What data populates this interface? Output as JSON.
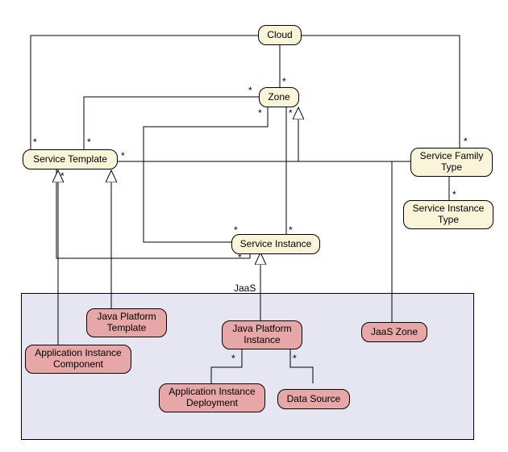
{
  "nodes": {
    "cloud": {
      "label": "Cloud"
    },
    "zone": {
      "label": "Zone"
    },
    "service_template": {
      "label": "Service Template"
    },
    "service_family_type": {
      "label": "Service Family\nType"
    },
    "service_instance_type": {
      "label": "Service Instance\nType"
    },
    "service_instance": {
      "label": "Service Instance"
    },
    "java_platform_template": {
      "label": "Java Platform\nTemplate"
    },
    "application_instance_component": {
      "label": "Application Instance\nComponent"
    },
    "java_platform_instance": {
      "label": "Java Platform\nInstance"
    },
    "application_instance_deployment": {
      "label": "Application Instance\nDeployment"
    },
    "data_source": {
      "label": "Data Source"
    },
    "jaas_zone": {
      "label": "JaaS Zone"
    }
  },
  "container": {
    "label": "JaaS"
  },
  "multiplicity": "*",
  "chart_data": {
    "type": "diagram",
    "title": "",
    "nodes": [
      {
        "id": "cloud",
        "label": "Cloud",
        "stereotype": "generic"
      },
      {
        "id": "zone",
        "label": "Zone",
        "stereotype": "generic"
      },
      {
        "id": "service_template",
        "label": "Service Template",
        "stereotype": "generic"
      },
      {
        "id": "service_family_type",
        "label": "Service Family Type",
        "stereotype": "generic"
      },
      {
        "id": "service_instance_type",
        "label": "Service Instance Type",
        "stereotype": "generic"
      },
      {
        "id": "service_instance",
        "label": "Service Instance",
        "stereotype": "generic"
      },
      {
        "id": "java_platform_template",
        "label": "Java Platform Template",
        "stereotype": "jaas"
      },
      {
        "id": "application_instance_component",
        "label": "Application Instance Component",
        "stereotype": "jaas"
      },
      {
        "id": "java_platform_instance",
        "label": "Java Platform Instance",
        "stereotype": "jaas"
      },
      {
        "id": "application_instance_deployment",
        "label": "Application Instance Deployment",
        "stereotype": "jaas"
      },
      {
        "id": "data_source",
        "label": "Data Source",
        "stereotype": "jaas"
      },
      {
        "id": "jaas_zone",
        "label": "JaaS Zone",
        "stereotype": "jaas"
      }
    ],
    "containers": [
      {
        "id": "jaas",
        "label": "JaaS",
        "members": [
          "java_platform_template",
          "application_instance_component",
          "java_platform_instance",
          "application_instance_deployment",
          "data_source",
          "jaas_zone"
        ]
      }
    ],
    "associations": [
      {
        "from": "cloud",
        "to": "zone",
        "from_mult": "",
        "to_mult": "*"
      },
      {
        "from": "cloud",
        "to": "service_template",
        "from_mult": "",
        "to_mult": "*"
      },
      {
        "from": "cloud",
        "to": "service_family_type",
        "from_mult": "",
        "to_mult": "*"
      },
      {
        "from": "zone",
        "to": "service_template",
        "from_mult": "*",
        "to_mult": "*"
      },
      {
        "from": "zone",
        "to": "service_instance",
        "from_mult": "*",
        "to_mult": "*"
      },
      {
        "from": "service_family_type",
        "to": "service_template",
        "from_mult": "",
        "to_mult": "*"
      },
      {
        "from": "service_family_type",
        "to": "service_instance_type",
        "from_mult": "",
        "to_mult": "*"
      },
      {
        "from": "service_template",
        "to": "service_instance",
        "from_mult": "*",
        "to_mult": "*"
      },
      {
        "from": "java_platform_instance",
        "to": "application_instance_deployment",
        "from_mult": "",
        "to_mult": "*"
      },
      {
        "from": "java_platform_instance",
        "to": "data_source",
        "from_mult": "",
        "to_mult": "*"
      }
    ],
    "generalizations": [
      {
        "child": "java_platform_template",
        "parent": "service_template"
      },
      {
        "child": "application_instance_component",
        "parent": "service_template"
      },
      {
        "child": "java_platform_instance",
        "parent": "service_instance"
      },
      {
        "child": "jaas_zone",
        "parent": "zone"
      }
    ]
  }
}
